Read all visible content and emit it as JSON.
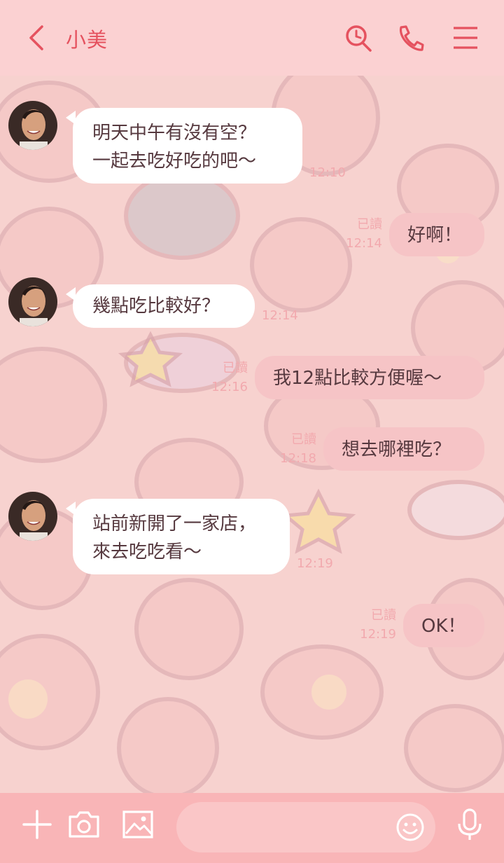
{
  "header": {
    "contact_name": "小美"
  },
  "messages": [
    {
      "side": "incoming",
      "lines": [
        "明天中午有沒有空？",
        "一起去吃好吃的吧～"
      ],
      "time": "12:10"
    },
    {
      "side": "outgoing",
      "lines": [
        "好啊！"
      ],
      "read": "已讀",
      "time": "12:14"
    },
    {
      "side": "incoming",
      "lines": [
        "幾點吃比較好？"
      ],
      "time": "12:14"
    },
    {
      "side": "outgoing",
      "lines": [
        "我12點比較方便喔～"
      ],
      "read": "已讀",
      "time": "12:16"
    },
    {
      "side": "outgoing",
      "lines": [
        "想去哪裡吃？"
      ],
      "read": "已讀",
      "time": "12:18"
    },
    {
      "side": "incoming",
      "lines": [
        "站前新開了一家店，",
        "來去吃吃看～"
      ],
      "time": "12:19"
    },
    {
      "side": "outgoing",
      "lines": [
        "OK！"
      ],
      "read": "已讀",
      "time": "12:19"
    }
  ],
  "composer": {
    "placeholder": ""
  },
  "icons": {
    "back": "chevron-left-icon",
    "search": "search-icon",
    "call": "phone-icon",
    "menu": "menu-icon",
    "plus": "plus-icon",
    "camera": "camera-icon",
    "image": "image-icon",
    "emoji": "emoji-icon",
    "mic": "microphone-icon"
  },
  "colors": {
    "accent": "#e5525f",
    "header_bg": "#fbd1d2",
    "chat_bg": "#f7d2cf",
    "outgoing_bubble": "#f6c4c6",
    "incoming_bubble": "#ffffff",
    "meta_text": "#f2a9ae",
    "bottom_bar": "#f9b5b7"
  }
}
